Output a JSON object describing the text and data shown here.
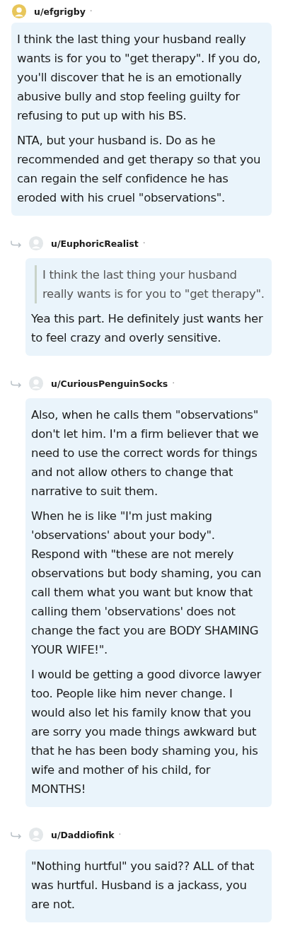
{
  "comment": {
    "author": "u/efgrigby",
    "dot": "·",
    "body": [
      {
        "kind": "text",
        "text": "I think the last thing your husband really wants is for you to \"get therapy\". If you do, you'll discover that he is an emotionally abusive bully and stop feeling guilty for refusing to put up with his BS."
      },
      {
        "kind": "text",
        "text": "NTA, but your husband is. Do as he recommended and get therapy so that you can regain the self confidence he has eroded with his cruel \"observations\"."
      }
    ],
    "children": [
      {
        "author": "u/EuphoricRealist",
        "dot": "·",
        "body": [
          {
            "kind": "quote",
            "text": "I think the last thing your husband really wants is for you to \"get therapy\"."
          },
          {
            "kind": "text",
            "text": "Yea this part. He definitely just wants her to feel crazy and overly sensitive."
          }
        ]
      },
      {
        "author": "u/CuriousPenguinSocks",
        "dot": "·",
        "body": [
          {
            "kind": "text",
            "text": "Also, when he calls them \"observations\" don't let him. I'm a firm believer that we need to use the correct words for things and not allow others to change that narrative to suit them."
          },
          {
            "kind": "text",
            "text": "When he is like \"I'm just making 'observations' about your body\". Respond with \"these are not merely observations but body shaming, you can call them what you want but know that calling them 'observations' does not change the fact you are BODY SHAMING YOUR WIFE!\"."
          },
          {
            "kind": "text",
            "text": "I would be getting a good divorce lawyer too. People like him never change. I would also let his family know that you are sorry you made things awkward but that he has been body shaming you, his wife and mother of his child, for MONTHS!"
          }
        ]
      },
      {
        "author": "u/Daddiofink",
        "dot": "·",
        "body": [
          {
            "kind": "text",
            "text": "\"Nothing hurtful\" you said?? ALL of that was hurtful. Husband is a jackass, you are not."
          }
        ]
      }
    ]
  }
}
